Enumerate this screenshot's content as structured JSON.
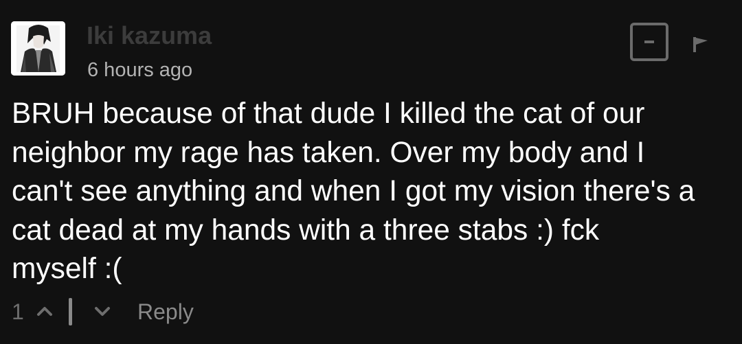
{
  "comment": {
    "username": "Iki kazuma",
    "timestamp": "6 hours ago",
    "body_lines": [
      "BRUH because of that dude I killed the cat of our",
      "neighbor my rage has taken. Over my body and I",
      "can't see anything and when I got my vision there's a",
      "cat dead at my hands with a three stabs :) fck",
      "myself :("
    ],
    "vote_count": "1",
    "reply_label": "Reply"
  },
  "icons": {
    "collapse": "minus-square-icon",
    "flag": "flag-icon",
    "upvote": "chevron-up-icon",
    "downvote": "chevron-down-icon"
  },
  "colors": {
    "background": "#111111",
    "body_text": "#ffffff",
    "username": "#3c3c3c",
    "timestamp": "#b3b3b3",
    "icon_gray": "#6b6b6b"
  }
}
